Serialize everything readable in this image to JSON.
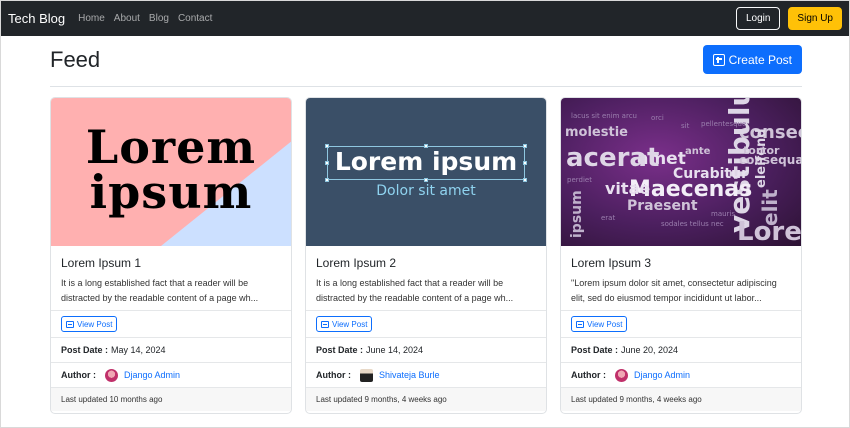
{
  "navbar": {
    "brand": "Tech Blog",
    "links": [
      "Home",
      "About",
      "Blog",
      "Contact"
    ],
    "login_label": "Login",
    "signup_label": "Sign Up"
  },
  "header": {
    "title": "Feed",
    "create_label": "Create Post"
  },
  "labels": {
    "view_post": "View Post",
    "post_date": "Post Date :",
    "author": "Author :"
  },
  "posts": [
    {
      "image_text": [
        "Lorem",
        "ipsum"
      ],
      "title": "Lorem Ipsum 1",
      "excerpt": "It is a long established fact that a reader will be distracted by the readable content of a page wh...",
      "post_date": "May 14, 2024",
      "author": "Django Admin",
      "last_updated": "Last updated 10 months ago"
    },
    {
      "image_text": [
        "Lorem ipsum",
        "Dolor sit amet"
      ],
      "title": "Lorem Ipsum 2",
      "excerpt": "It is a long established fact that a reader will be distracted by the readable content of a page wh...",
      "post_date": "June 14, 2024",
      "author": "Shivateja Burle",
      "last_updated": "Last updated 9 months, 4 weeks ago"
    },
    {
      "image_words": [
        "consec",
        "vestibulum",
        "Maecenas",
        "amet",
        "acerat",
        "Lorem",
        "vitae",
        "Praesent",
        "Curabitur",
        "elit",
        "molestie",
        "ipsum",
        "consequat",
        "eleifend",
        "tortor",
        "ante"
      ],
      "title": "Lorem Ipsum 3",
      "excerpt": "\"Lorem ipsum dolor sit amet, consectetur adipiscing elit, sed do eiusmod tempor incididunt ut labor...",
      "post_date": "June 20, 2024",
      "author": "Django Admin",
      "last_updated": "Last updated 9 months, 4 weeks ago"
    }
  ],
  "colors": {
    "navbar_bg": "#212529",
    "primary": "#0d6efd",
    "warning": "#ffc107"
  }
}
